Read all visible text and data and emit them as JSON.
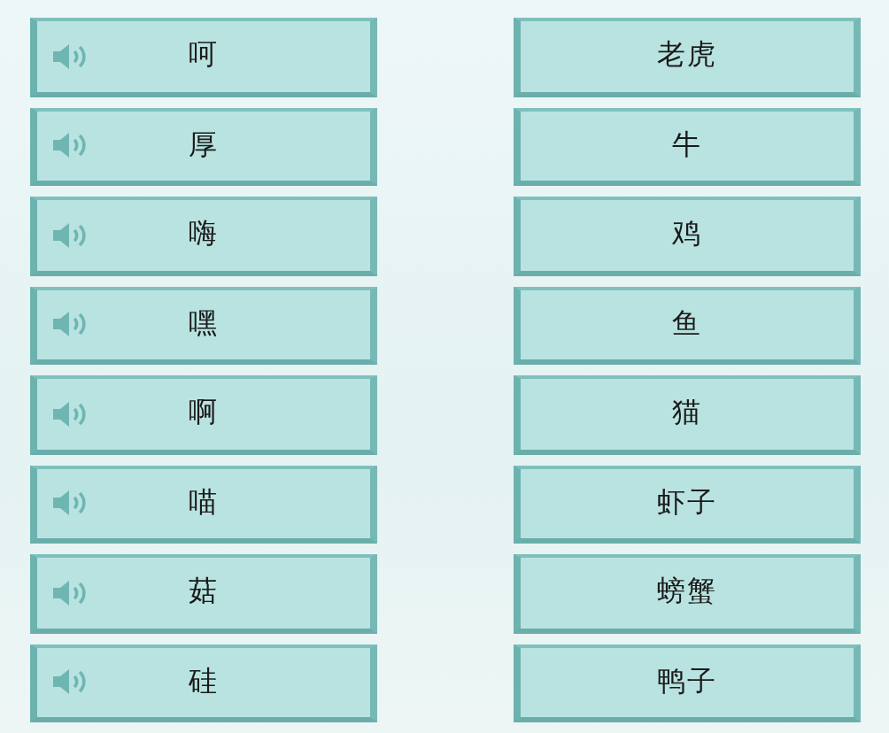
{
  "sounds": [
    {
      "text": "呵"
    },
    {
      "text": "厚"
    },
    {
      "text": "嗨"
    },
    {
      "text": "嘿"
    },
    {
      "text": "啊"
    },
    {
      "text": "喵"
    },
    {
      "text": "菇"
    },
    {
      "text": "硅"
    }
  ],
  "words": [
    {
      "text": "老虎"
    },
    {
      "text": "牛"
    },
    {
      "text": "鸡"
    },
    {
      "text": "鱼"
    },
    {
      "text": "猫"
    },
    {
      "text": "虾子"
    },
    {
      "text": "螃蟹"
    },
    {
      "text": "鸭子"
    }
  ]
}
